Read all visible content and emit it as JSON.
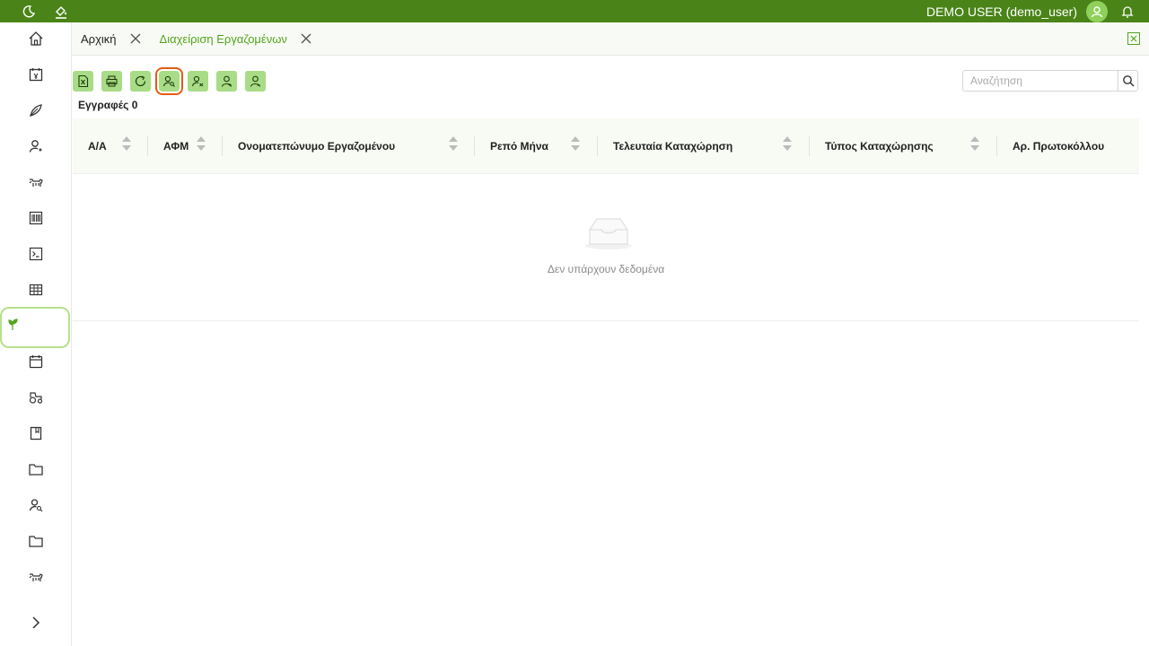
{
  "topbar": {
    "user_label": "DEMO USER (demo_user)",
    "icons": [
      "moon-icon",
      "paint-bucket-icon",
      "avatar",
      "bell-icon"
    ],
    "color": "#4a8418"
  },
  "sidebar": {
    "items": [
      "home-icon",
      "calendar-money-icon",
      "leaf-icon",
      "user-sync-icon",
      "cow-icon",
      "barcode-icon",
      "terminal-icon",
      "table-icon",
      "plant-icon",
      "calendar-icon",
      "tractor-icon",
      "book-icon",
      "folder-icon",
      "user-search-icon",
      "folder-icon",
      "cow-icon",
      "chevron-right-icon"
    ],
    "active_index": 8
  },
  "tabs": [
    {
      "label": "Αρχική",
      "active": false
    },
    {
      "label": "Διαχείριση Εργαζομένων",
      "active": true
    }
  ],
  "toolbar": {
    "buttons": [
      "excel-export-icon",
      "printer-icon",
      "refresh-icon",
      "user-search-icon",
      "user-remove-icon",
      "user-add-icon",
      "user-minus-icon"
    ],
    "highlighted_index": 3,
    "accent": "#a8dc86",
    "highlight": "#e35b16"
  },
  "records_label": "Εγγραφές 0",
  "search": {
    "placeholder": "Αναζήτηση",
    "value": ""
  },
  "table": {
    "columns": [
      "Α/Α",
      "ΑΦΜ",
      "Ονοματεπώνυμο Εργαζομένου",
      "Ρεπό Μήνα",
      "Τελευταία Καταχώρηση",
      "Τύπος Καταχώρησης",
      "Αρ. Πρωτοκόλλου"
    ],
    "rows": [],
    "empty_text": "Δεν υπάρχουν δεδομένα"
  }
}
